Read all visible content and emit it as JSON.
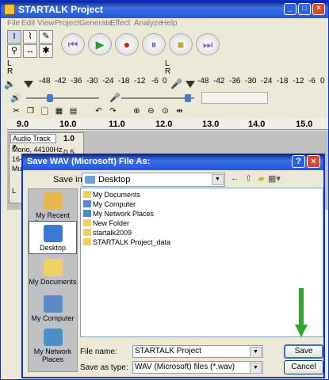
{
  "main_window": {
    "title": "STARTALK Project",
    "controls": {
      "minimize": "_",
      "maximize": "□",
      "close": "×"
    }
  },
  "menu": [
    "File",
    "Edit",
    "View",
    "Project",
    "Generate",
    "Effect",
    "Analyze",
    "Help"
  ],
  "tools": [
    {
      "name": "selection-tool",
      "glyph": "I"
    },
    {
      "name": "envelope-tool",
      "glyph": "⌇"
    },
    {
      "name": "draw-tool",
      "glyph": "✎"
    },
    {
      "name": "zoom-tool",
      "glyph": "⚲"
    },
    {
      "name": "timeshift-tool",
      "glyph": "↔"
    },
    {
      "name": "multi-tool",
      "glyph": "✱"
    }
  ],
  "transport": [
    {
      "name": "skip-start-button",
      "glyph": "⏮",
      "color": "#8a5fc4"
    },
    {
      "name": "play-button",
      "glyph": "▶",
      "color": "#2f9e2f"
    },
    {
      "name": "record-button",
      "glyph": "●",
      "color": "#c42020"
    },
    {
      "name": "pause-button",
      "glyph": "⏸",
      "color": "#6a4fb0"
    },
    {
      "name": "stop-button",
      "glyph": "■",
      "color": "#c8a43a"
    },
    {
      "name": "skip-end-button",
      "glyph": "⏭",
      "color": "#8a5fc4"
    }
  ],
  "meters": {
    "left_label": "L",
    "right_label": "R",
    "scale": [
      "-48",
      "-42",
      "-36",
      "-30",
      "-24",
      "-18",
      "-12",
      "-6",
      "0"
    ]
  },
  "ruler": [
    "9.0",
    "10.0",
    "11.0",
    "12.0",
    "13.0",
    "14.0",
    "15.0"
  ],
  "track": {
    "name": "Audio Track",
    "scale_top": "1.0",
    "scale_mid": "0.5",
    "info": [
      "Mono, 44100Hz",
      "16-bit",
      "Mute"
    ],
    "l_label": "L"
  },
  "dialog": {
    "title": "Save WAV (Microsoft) File As:",
    "help": "?",
    "close": "×",
    "save_in_label": "Save in:",
    "save_in_value": "Desktop",
    "places": [
      {
        "label": "My Recent Documents",
        "color": "#e8b84a"
      },
      {
        "label": "Desktop",
        "color": "#3a78d8",
        "selected": true
      },
      {
        "label": "My Documents",
        "color": "#f0d060"
      },
      {
        "label": "My Computer",
        "color": "#5c8ac8"
      },
      {
        "label": "My Network Places",
        "color": "#4a90c8"
      }
    ],
    "files": [
      {
        "label": "My Documents",
        "color": "#f0d060"
      },
      {
        "label": "My Computer",
        "color": "#5c8ac8"
      },
      {
        "label": "My Network Places",
        "color": "#4a90c8"
      },
      {
        "label": "New Folder",
        "color": "#f0d060"
      },
      {
        "label": "startalk2009",
        "color": "#f0d060"
      },
      {
        "label": "STARTALK Project_data",
        "color": "#f0d060"
      }
    ],
    "file_name_label": "File name:",
    "file_name_value": "STARTALK Project",
    "save_as_type_label": "Save as type:",
    "save_as_type_value": "WAV (Microsoft) files (*.wav)",
    "save_button": "Save",
    "cancel_button": "Cancel"
  },
  "accent_arrow_color": "#2fa82f"
}
